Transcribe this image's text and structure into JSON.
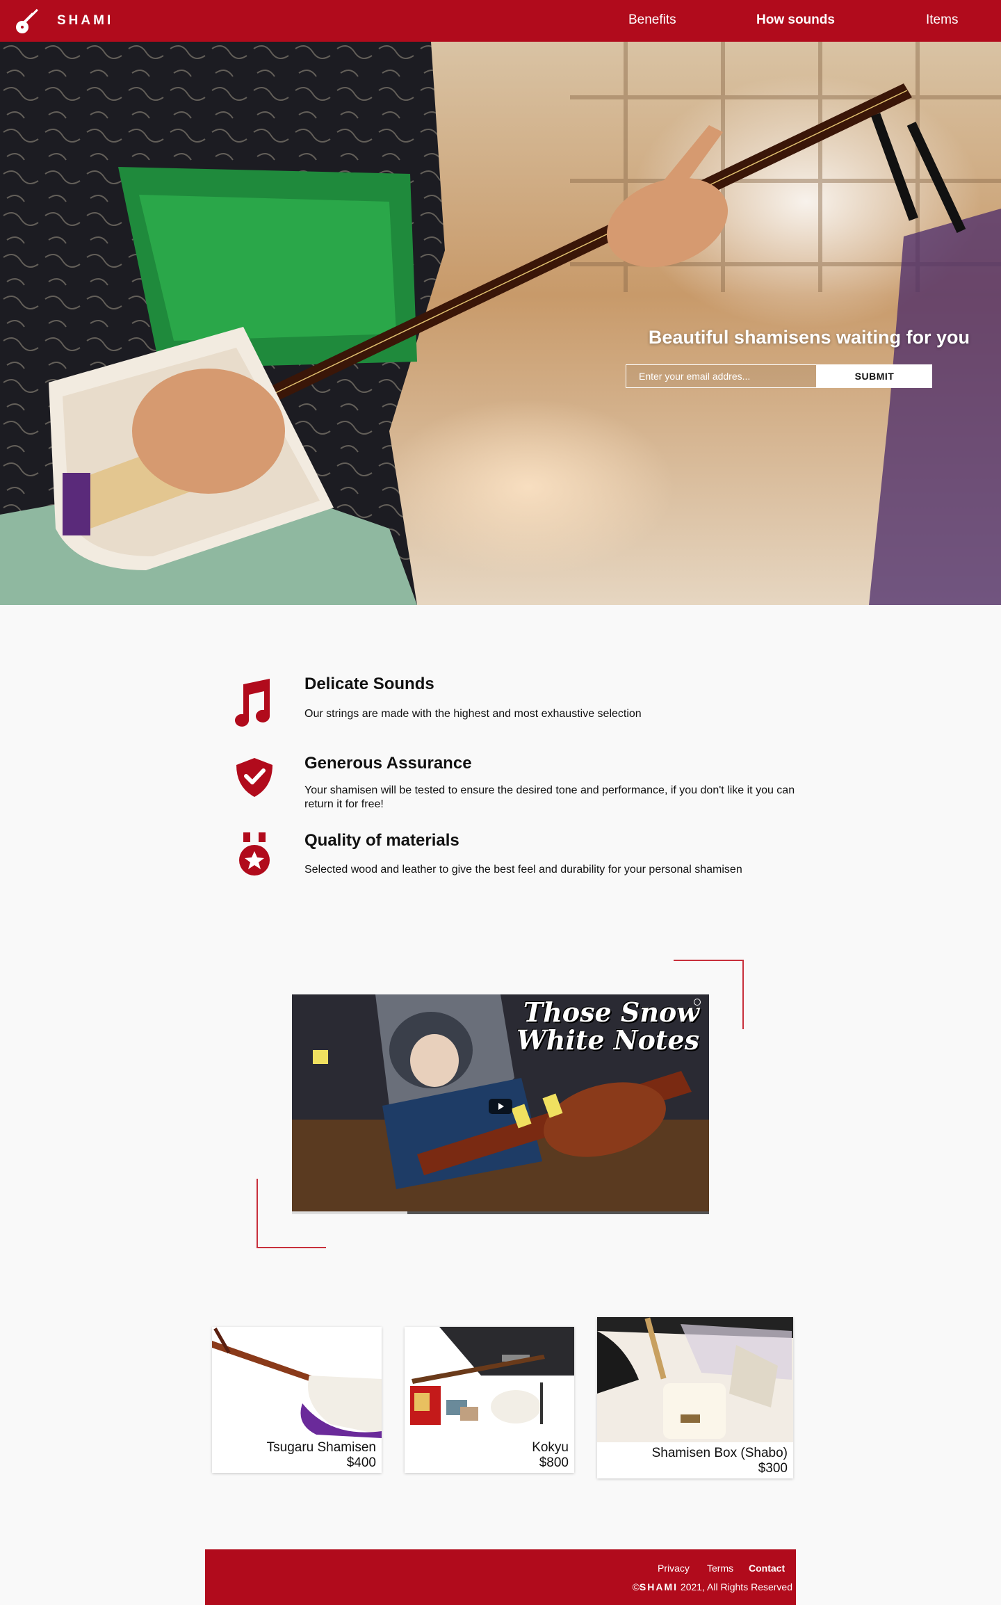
{
  "header": {
    "brand": "SHAMI",
    "nav": [
      {
        "label": "Benefits"
      },
      {
        "label": "How sounds"
      },
      {
        "label": "Items"
      }
    ]
  },
  "hero": {
    "headline": "Beautiful shamisens waiting for you",
    "email_placeholder": "Enter your email addres...",
    "submit_label": "SUBMIT"
  },
  "benefits": [
    {
      "title": "Delicate Sounds",
      "description": "Our strings are made with the highest and most exhaustive selection",
      "icon": "music-note-icon"
    },
    {
      "title": "Generous Assurance",
      "description": "Your shamisen will be tested to ensure the desired tone and performance, if you don't like it you can return it for free!",
      "icon": "shield-check-icon"
    },
    {
      "title": "Quality of materials",
      "description": "Selected wood and leather to give the best feel and durability for your personal shamisen",
      "icon": "medal-star-icon"
    }
  ],
  "video": {
    "caption_line1": "Those Snow",
    "caption_line2": "White Notes"
  },
  "products": [
    {
      "name": "Tsugaru Shamisen",
      "price": "$400"
    },
    {
      "name": "Kokyu",
      "price": "$800"
    },
    {
      "name": "Shamisen Box (Shabo)",
      "price": "$300"
    }
  ],
  "footer": {
    "links": [
      {
        "label": "Privacy"
      },
      {
        "label": "Terms"
      },
      {
        "label": "Contact"
      }
    ],
    "copyright_symbol": "©",
    "copyright_brand": "SHAMI",
    "copyright_text": " 2021, All Rights Reserved"
  },
  "colors": {
    "brand_red": "#b10b1c",
    "background": "#f9f9f9"
  }
}
